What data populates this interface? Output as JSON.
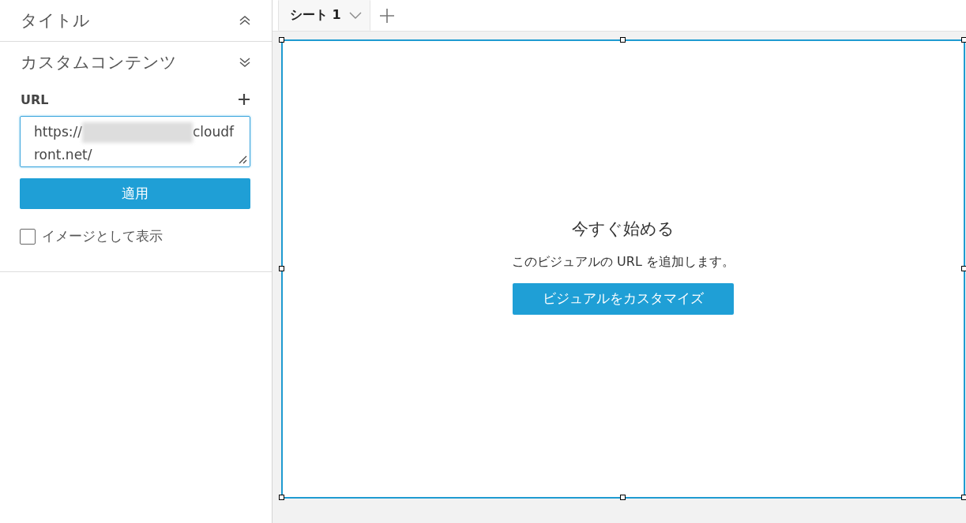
{
  "sidebar": {
    "sections": [
      {
        "title": "タイトル",
        "expanded": false
      },
      {
        "title": "カスタムコンテンツ",
        "expanded": true,
        "url_label": "URL",
        "url_field": {
          "value_start": "https://",
          "value_end": "cloudfront.net/"
        },
        "apply_button": "適用",
        "checkbox": {
          "label": "イメージとして表示",
          "checked": false
        }
      }
    ]
  },
  "tabs": [
    {
      "label": "シート 1",
      "selected": true
    }
  ],
  "visual": {
    "selected": true,
    "heading": "今すぐ始める",
    "message": "このビジュアルの URL を追加します。",
    "button": "ビジュアルをカスタマイズ"
  }
}
